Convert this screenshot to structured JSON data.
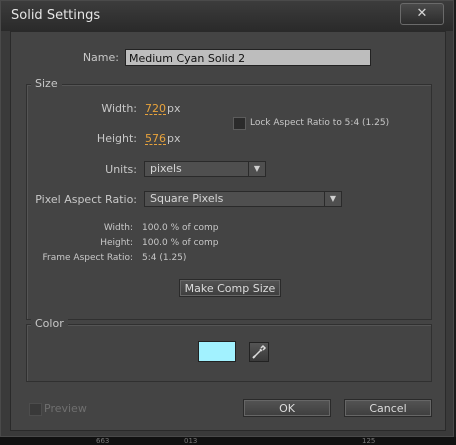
{
  "window": {
    "title": "Solid Settings",
    "close_glyph": "✕"
  },
  "name_field": {
    "label": "Name:",
    "value": "Medium Cyan Solid 2"
  },
  "size_group": {
    "title": "Size",
    "width_label": "Width:",
    "width_value": "720",
    "width_unit": "px",
    "height_label": "Height:",
    "height_value": "576",
    "height_unit": "px",
    "lock_aspect_label": "Lock Aspect Ratio to 5:4 (1.25)",
    "lock_aspect_checked": false,
    "units_label": "Units:",
    "units_value": "pixels",
    "par_label": "Pixel Aspect Ratio:",
    "par_value": "Square Pixels",
    "info": {
      "width_label": "Width:",
      "width_value": "100.0 % of comp",
      "height_label": "Height:",
      "height_value": "100.0 % of comp",
      "far_label": "Frame Aspect Ratio:",
      "far_value": "5:4 (1.25)"
    },
    "make_comp_size_label": "Make Comp Size"
  },
  "color_group": {
    "title": "Color",
    "swatch_color": "#a2f2ff",
    "eyedropper_icon": "eyedropper-icon"
  },
  "footer": {
    "preview_label": "Preview",
    "preview_checked": false,
    "ok_label": "OK",
    "cancel_label": "Cancel"
  },
  "background_strip": {
    "labels": [
      "663",
      "013",
      "125"
    ]
  },
  "colors": {
    "accent": "#e8a33c",
    "panel": "#444444"
  }
}
